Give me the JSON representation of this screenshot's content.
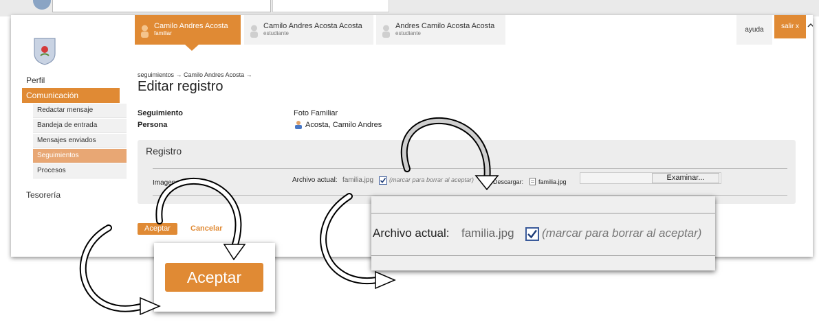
{
  "header": {
    "tabs": [
      {
        "name": "Camilo Andres Acosta",
        "role": "familiar"
      },
      {
        "name": "Camilo Andres Acosta Acosta",
        "role": "estudiante"
      },
      {
        "name": "Andres Camilo Acosta Acosta",
        "role": "estudiante"
      }
    ],
    "help": "ayuda",
    "logout": "salir x"
  },
  "sidebar": {
    "perfil": "Perfil",
    "comunicacion": "Comunicación",
    "items": [
      "Redactar mensaje",
      "Bandeja de entrada",
      "Mensajes enviados",
      "Seguimientos",
      "Procesos"
    ],
    "tesoreria": "Tesorería"
  },
  "breadcrumb": "seguimientos  →  Camilo Andres Acosta  →",
  "page_title": "Editar registro",
  "fields": {
    "seguimiento_label": "Seguimiento",
    "seguimiento_value": "Foto Familiar",
    "persona_label": "Persona",
    "persona_value": "Acosta, Camilo Andres"
  },
  "registro": {
    "title": "Registro",
    "imagen_label": "Imagen",
    "archivo_label": "Archivo actual:",
    "archivo_file": "familia.jpg",
    "delete_hint": "(marcar para borrar al aceptar)",
    "descargar_label": "Descargar:",
    "descargar_file": "familia.jpg",
    "browse_button": "Examinar..."
  },
  "buttons": {
    "accept": "Aceptar",
    "cancel": "Cancelar"
  },
  "zoom": {
    "archivo_label": "Archivo actual:",
    "archivo_file": "familia.jpg",
    "delete_hint": "(marcar para borrar al aceptar)",
    "accept": "Aceptar"
  },
  "colors": {
    "accent": "#e08a34",
    "selected_item": "#e8a774",
    "panel": "#ededed"
  }
}
